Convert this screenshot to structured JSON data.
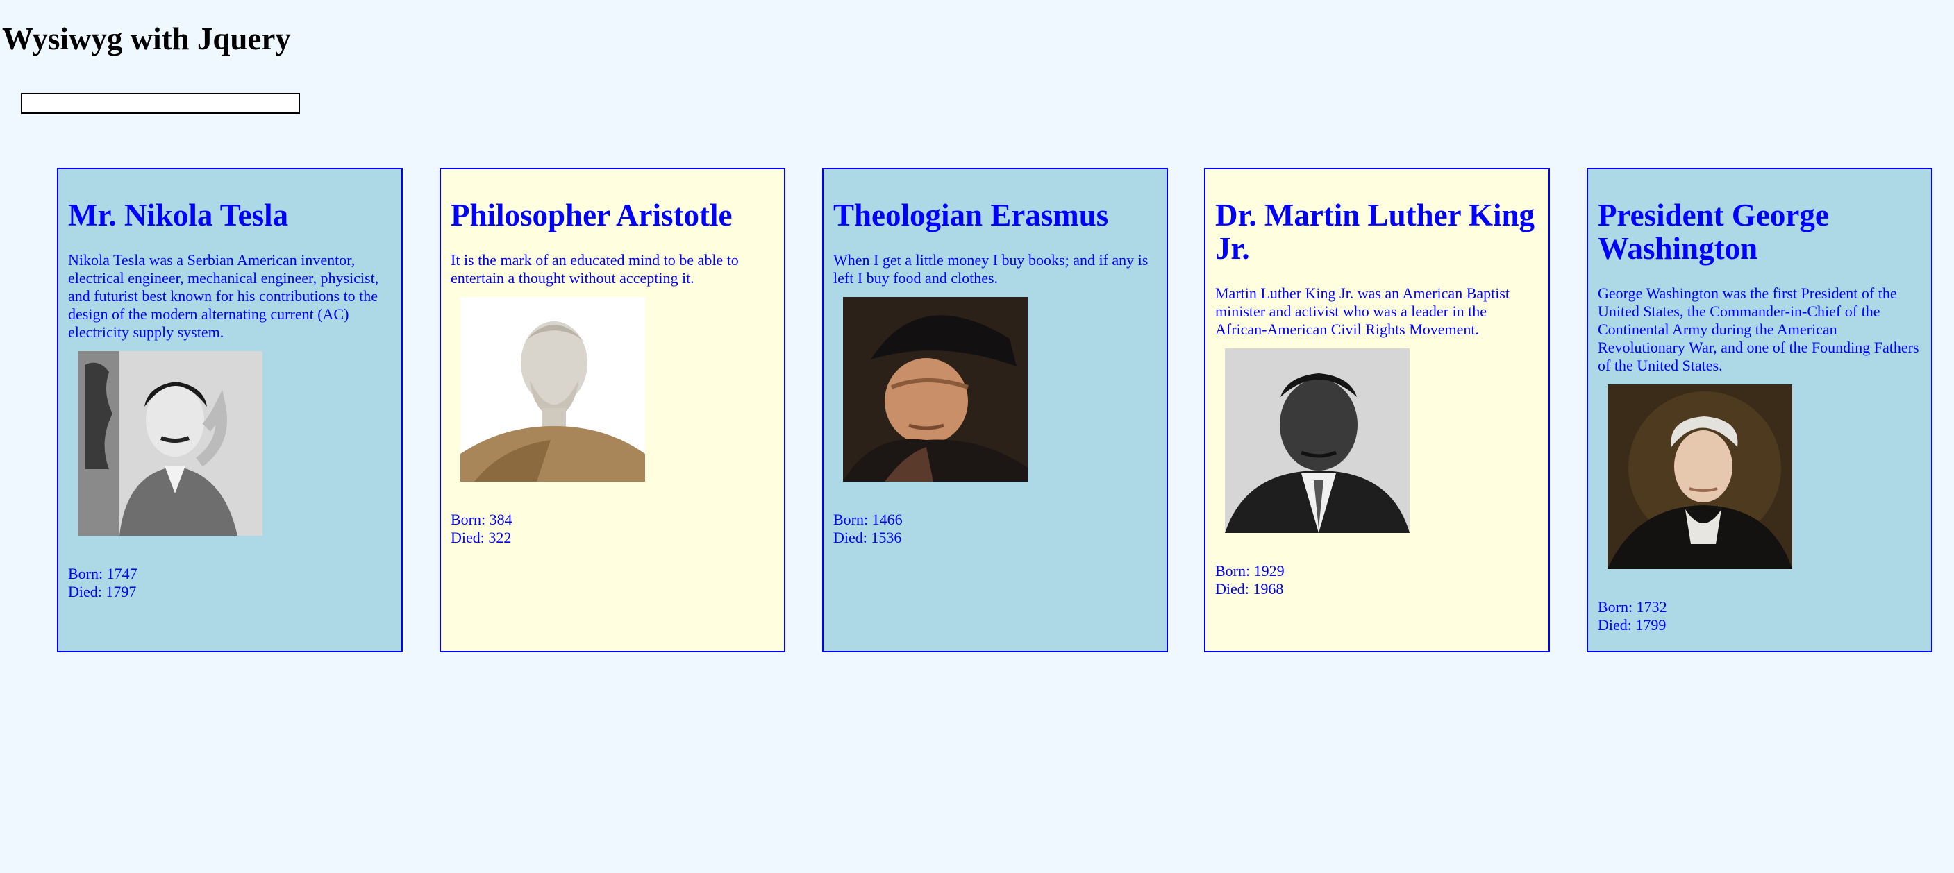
{
  "page": {
    "title": "Wysiwyg with Jquery",
    "search": {
      "value": "",
      "placeholder": ""
    }
  },
  "cards": [
    {
      "name": "Mr. Nikola Tesla",
      "description": "Nikola Tesla was a Serbian American inventor, electrical engineer, mechanical engineer, physicist, and futurist best known for his contributions to the design of the modern alternating current (AC) electricity supply system.",
      "portrait": "nikola-tesla-portrait",
      "born": "Born: 1747",
      "died": "Died: 1797",
      "background": "#add8e6"
    },
    {
      "name": "Philosopher Aristotle",
      "description": "It is the mark of an educated mind to be able to entertain a thought without accepting it.",
      "portrait": "aristotle-bust-portrait",
      "born": "Born: 384",
      "died": "Died: 322",
      "background": "#ffffe0"
    },
    {
      "name": "Theologian Erasmus",
      "description": "When I get a little money I buy books; and if any is left I buy food and clothes.",
      "portrait": "erasmus-portrait",
      "born": "Born: 1466",
      "died": "Died: 1536",
      "background": "#add8e6"
    },
    {
      "name": "Dr. Martin Luther King Jr.",
      "description": "Martin Luther King Jr. was an American Baptist minister and activist who was a leader in the African-American Civil Rights Movement.",
      "portrait": "martin-luther-king-portrait",
      "born": "Born: 1929",
      "died": "Died: 1968",
      "background": "#ffffe0"
    },
    {
      "name": "President George Washington",
      "description": "George Washington was the first President of the United States, the Commander-in-Chief of the Continental Army during the American Revolutionary War, and one of the Founding Fathers of the United States.",
      "portrait": "george-washington-portrait",
      "born": "Born: 1732",
      "died": "Died: 1799",
      "background": "#add8e6"
    }
  ],
  "colors": {
    "page_background": "#f0f8ff",
    "card_border": "#0000ff",
    "card_text": "#0000ff"
  }
}
